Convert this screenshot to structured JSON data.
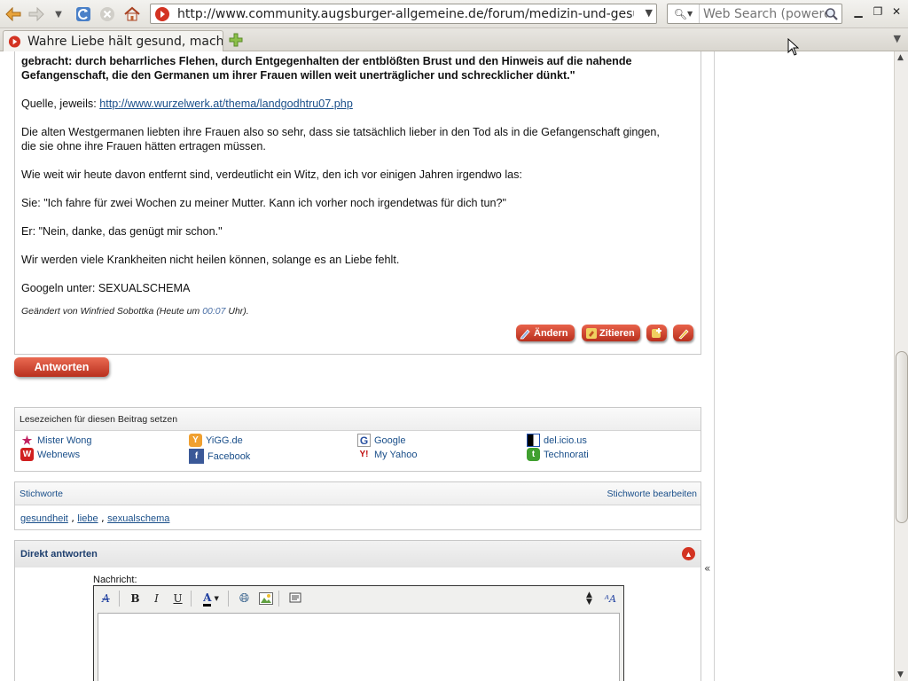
{
  "browser": {
    "url": "http://www.community.augsburger-allgemeine.de/forum/medizin-und-gesundl",
    "search_placeholder": "Web Search (powered",
    "tab_title": "Wahre Liebe hält gesund, mach..."
  },
  "post": {
    "quote_line1": "gebracht: durch beharrliches Flehen, durch Entgegenhalten der entblößten Brust und den Hinweis auf die nahende",
    "quote_line2": "Gefangenschaft, die den Germanen um ihrer Frauen willen weit unerträglicher und schrecklicher dünkt.\"",
    "source_label": "Quelle, jeweils: ",
    "source_url": "http://www.wurzelwerk.at/thema/landgodhtru07.php",
    "para1_line1": "Die alten Westgermanen liebten ihre Frauen also so sehr, dass sie tatsächlich lieber in den Tod als in die Gefangenschaft gingen,",
    "para1_line2": "die sie ohne ihre Frauen hätten ertragen müssen.",
    "para2": "Wie weit wir heute davon entfernt sind, verdeutlicht ein Witz, den ich vor einigen Jahren irgendwo las:",
    "para3": "Sie: \"Ich fahre für zwei Wochen zu meiner Mutter. Kann ich vorher noch irgendetwas für dich tun?\"",
    "para4": "Er: \"Nein, danke, das genügt mir schon.\"",
    "para5": "Wir werden viele Krankheiten nicht heilen können, solange es an Liebe fehlt.",
    "para6": "Googeln unter: SEXUALSCHEMA",
    "edit_note_prefix": "Geändert von Winfried Sobottka (Heute um ",
    "edit_time": "00:07",
    "edit_note_suffix": " Uhr).",
    "buttons": {
      "edit": "Ändern",
      "quote": "Zitieren"
    }
  },
  "reply_button": "Antworten",
  "bookmarks": {
    "title": "Lesezeichen für diesen Beitrag setzen",
    "items": [
      {
        "label": "Mister Wong"
      },
      {
        "label": "YiGG.de"
      },
      {
        "label": "Google"
      },
      {
        "label": "del.icio.us"
      },
      {
        "label": "Webnews"
      },
      {
        "label": "Facebook"
      },
      {
        "label": "My Yahoo"
      },
      {
        "label": "Technorati"
      }
    ]
  },
  "tags": {
    "title": "Stichworte",
    "edit_label": "Stichworte bearbeiten",
    "items": [
      "gesundheit",
      "liebe",
      "sexualschema"
    ]
  },
  "quick_reply": {
    "title": "Direkt antworten",
    "message_label": "Nachricht:"
  },
  "colors": {
    "button_red": "#c8402a",
    "link_blue": "#1a4f8a"
  }
}
